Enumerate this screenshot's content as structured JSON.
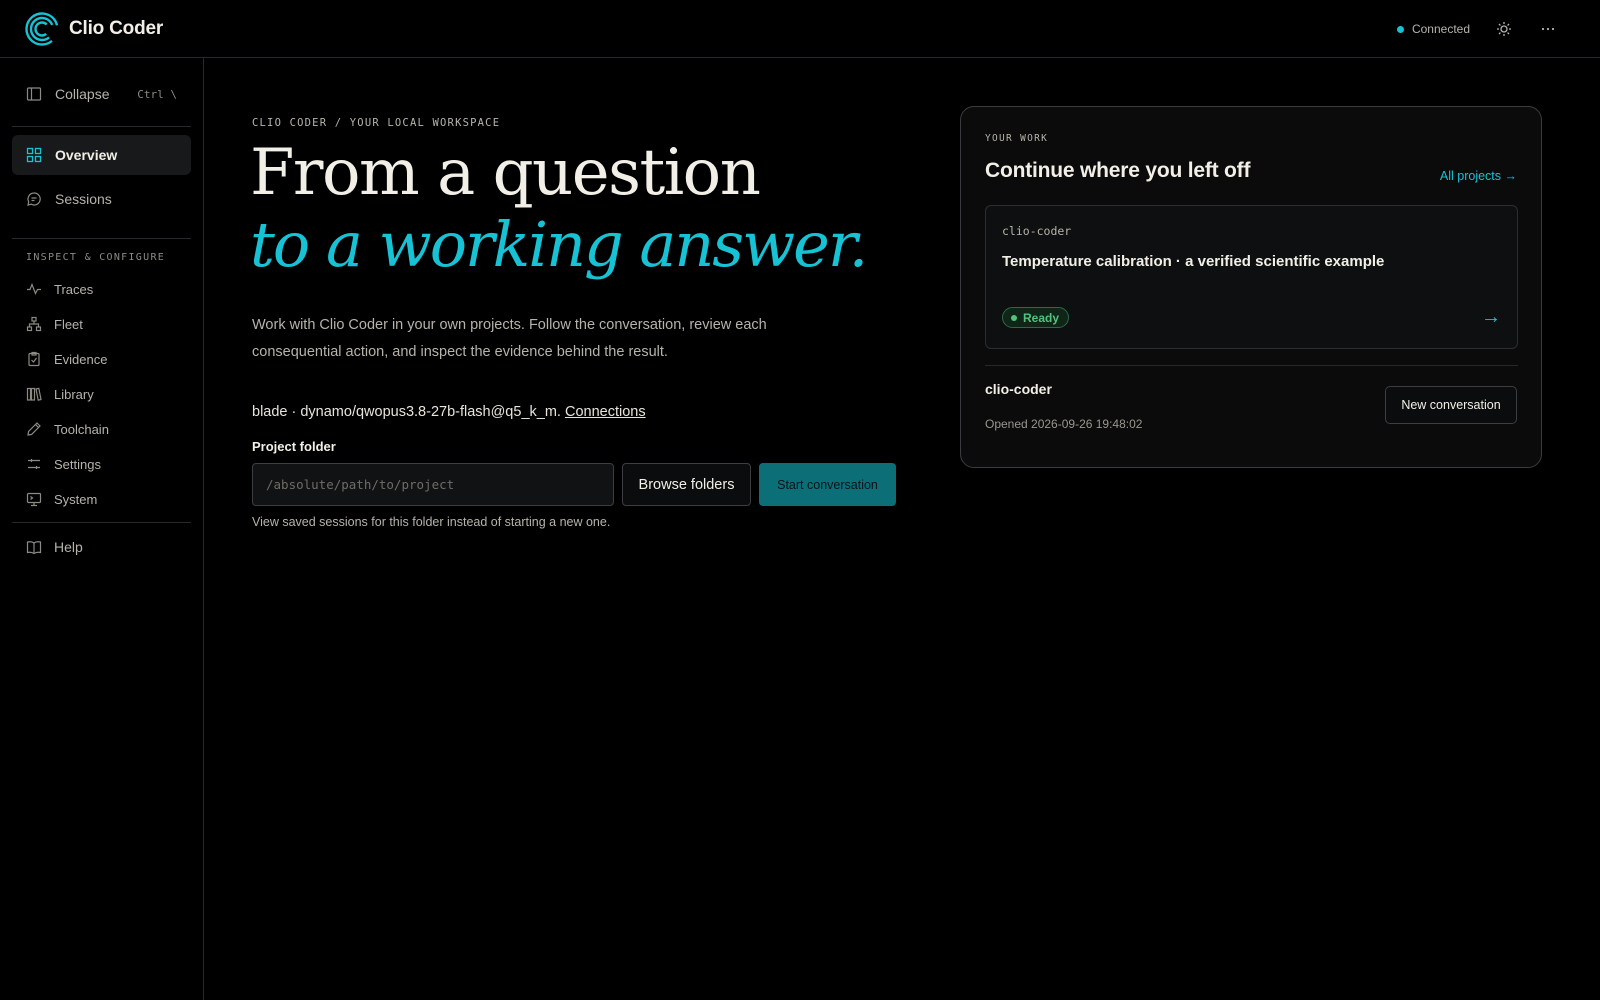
{
  "app": {
    "name": "Clio Coder"
  },
  "topbar": {
    "status": "Connected",
    "accent": "#17c2d4"
  },
  "sidebar": {
    "collapse": {
      "label": "Collapse",
      "shortcut": "Ctrl \\"
    },
    "main_items": [
      {
        "label": "Overview",
        "icon": "grid-icon",
        "active": true
      },
      {
        "label": "Sessions",
        "icon": "chat-bubble-icon",
        "active": false
      }
    ],
    "section_label": "INSPECT & CONFIGURE",
    "sub_items": [
      {
        "label": "Traces",
        "icon": "activity-icon"
      },
      {
        "label": "Fleet",
        "icon": "network-icon"
      },
      {
        "label": "Evidence",
        "icon": "clipboard-icon"
      },
      {
        "label": "Library",
        "icon": "books-icon"
      },
      {
        "label": "Toolchain",
        "icon": "pencil-icon"
      },
      {
        "label": "Settings",
        "icon": "sliders-icon"
      },
      {
        "label": "System",
        "icon": "monitor-icon"
      }
    ],
    "help": {
      "label": "Help",
      "icon": "book-icon"
    }
  },
  "hero": {
    "crumb": "CLIO CODER / YOUR LOCAL WORKSPACE",
    "title_line1": "From a question",
    "title_line2": "to a working answer.",
    "lede": "Work with Clio Coder in your own projects. Follow the conversation, review each consequential action, and inspect the evidence behind the result.",
    "model": "blade · dynamo/qwopus3.8-27b-flash@q5_k_m.",
    "connections_link": "Connections",
    "project_folder_label": "Project folder",
    "project_folder_placeholder": "/absolute/path/to/project",
    "project_folder_value": "",
    "browse_label": "Browse folders",
    "start_label": "Start conversation",
    "hint": "View saved sessions for this folder instead of starting a new one."
  },
  "your_work": {
    "kicker": "YOUR WORK",
    "title": "Continue where you left off",
    "all_projects": "All projects →",
    "project": {
      "slug": "clio-coder",
      "title": "Temperature calibration · a verified scientific example",
      "status": "Ready",
      "status_color": "#52c27d",
      "arrow": "→"
    },
    "recent": {
      "name": "clio-coder",
      "opened": "Opened 2026-09-26 19:48:02",
      "new_conversation": "New conversation"
    }
  }
}
